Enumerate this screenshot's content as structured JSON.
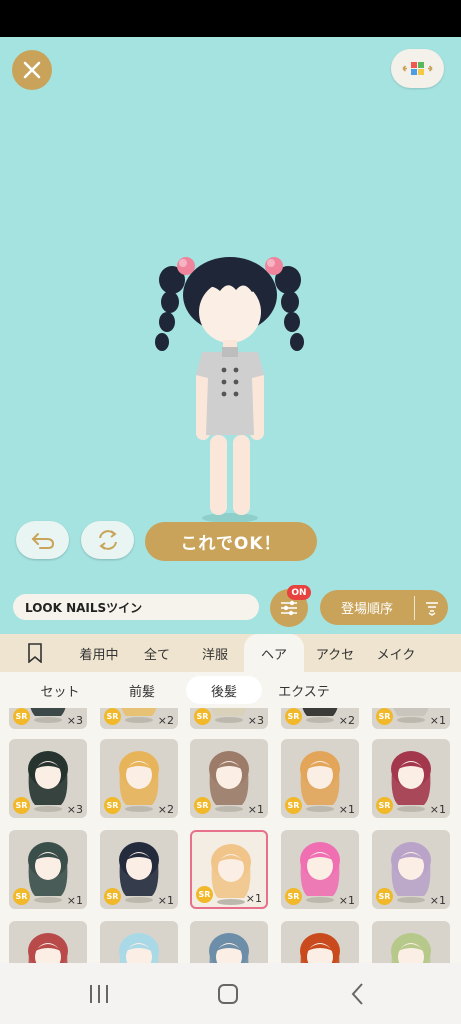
{
  "buttons": {
    "ok_label": "これでOK！",
    "on_badge": "ON",
    "sort_label": "登場順序"
  },
  "name_field": {
    "value": "LOOK NAILSツイン"
  },
  "tabs": [
    {
      "label": ""
    },
    {
      "label": "着用中"
    },
    {
      "label": "全て"
    },
    {
      "label": "洋服"
    },
    {
      "label": "ヘア"
    },
    {
      "label": "アクセ"
    },
    {
      "label": "メイク"
    }
  ],
  "subtabs": [
    {
      "label": "セット"
    },
    {
      "label": "前髪"
    },
    {
      "label": "後髪"
    },
    {
      "label": "エクステ"
    }
  ],
  "items": [
    {
      "rarity": "SR",
      "count": "×3",
      "hair_color": "#2b3a3a"
    },
    {
      "rarity": "SR",
      "count": "×2",
      "hair_color": "#e9bf6a"
    },
    {
      "rarity": "SR",
      "count": "×3",
      "hair_color": "#d9d0b8"
    },
    {
      "rarity": "SR",
      "count": "×2",
      "hair_color": "#2a2a2a"
    },
    {
      "rarity": "SR",
      "count": "×1",
      "hair_color": "#c8c3ba"
    },
    {
      "rarity": "SR",
      "count": "×3",
      "hair_color": "#26332f"
    },
    {
      "rarity": "SR",
      "count": "×2",
      "hair_color": "#e8b45a"
    },
    {
      "rarity": "SR",
      "count": "×1",
      "hair_color": "#9c7b68"
    },
    {
      "rarity": "SR",
      "count": "×1",
      "hair_color": "#e2a55a"
    },
    {
      "rarity": "SR",
      "count": "×1",
      "hair_color": "#a3384d"
    },
    {
      "rarity": "SR",
      "count": "×1",
      "hair_color": "#3b4f4a"
    },
    {
      "rarity": "SR",
      "count": "×1",
      "hair_color": "#242b3d"
    },
    {
      "rarity": "SR",
      "count": "×1",
      "hair_color": "#f1c58a"
    },
    {
      "rarity": "SR",
      "count": "×1",
      "hair_color": "#f06fb3"
    },
    {
      "rarity": "SR",
      "count": "×1",
      "hair_color": "#b9a3c8"
    },
    {
      "rarity": "",
      "count": "",
      "hair_color": "#b84a4a"
    },
    {
      "rarity": "",
      "count": "",
      "hair_color": "#a9d9e6"
    },
    {
      "rarity": "",
      "count": "",
      "hair_color": "#6d8ea8"
    },
    {
      "rarity": "",
      "count": "",
      "hair_color": "#c84a1d"
    },
    {
      "rarity": "",
      "count": "",
      "hair_color": "#b7c98a"
    }
  ],
  "colors": {
    "gold": "#c9a35a",
    "stage_bg": "#a5e3e1",
    "selected_border": "#e7708a",
    "badge_red": "#e8423f"
  }
}
